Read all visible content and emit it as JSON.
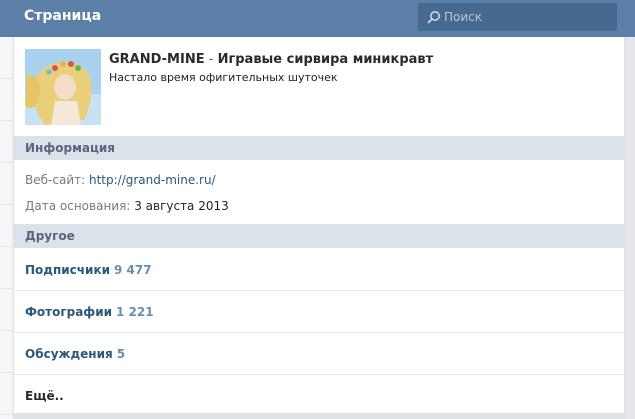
{
  "header": {
    "title": "Страница",
    "search_placeholder": "Поиск"
  },
  "profile": {
    "name": "GRAND-MINE",
    "dash": " - ",
    "subtitle": "Игравые сирвира миникравт",
    "status": "Настало время офигительных шуточек"
  },
  "info": {
    "header": "Информация",
    "website_label": "Веб-сайт:",
    "website_value": "http://grand-mine.ru/",
    "founded_label": "Дата основания:",
    "founded_value": "3 августа 2013"
  },
  "other": {
    "header": "Другое",
    "items": [
      {
        "label": "Подписчики",
        "count": "9 477"
      },
      {
        "label": "Фотографии",
        "count": "1 221"
      },
      {
        "label": "Обсуждения",
        "count": "5"
      },
      {
        "label": "Ещё..",
        "count": ""
      }
    ]
  },
  "colors": {
    "header_bg": "#5b7fa6",
    "section_bg": "#dce2e9",
    "link": "#2b587a",
    "count": "#6b8db1"
  }
}
